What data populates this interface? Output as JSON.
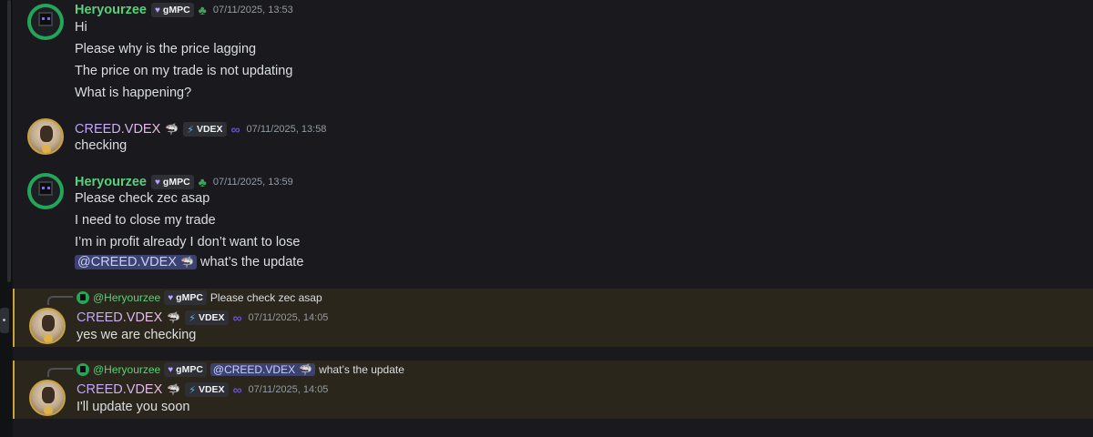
{
  "users": {
    "heryourzee": {
      "name": "Heryourzee",
      "tag": "gMPC",
      "mention": "@Heryourzee"
    },
    "creed": {
      "name": "CREED.VDEX",
      "tag": "VDEX",
      "mention": "@CREED.VDEX"
    }
  },
  "colors": {
    "green_name": "#57d17a",
    "highlight_border": "#c9a23b",
    "mention_bg": "#3c4270"
  },
  "icons": {
    "heart": "heart-icon",
    "clover": "clover-icon",
    "shark": "shark-icon",
    "bolt": "bolt-icon",
    "knot": "knot-icon"
  },
  "messages": [
    {
      "author": "Heryourzee",
      "timestamp": "07/11/2025, 13:53",
      "lines": [
        "Hi",
        "Please why is the price lagging",
        "The price on my trade is not updating",
        "What is happening?"
      ]
    },
    {
      "author": "CREED.VDEX",
      "timestamp": "07/11/2025, 13:58",
      "lines": [
        "checking"
      ]
    },
    {
      "author": "Heryourzee",
      "timestamp": "07/11/2025, 13:59",
      "lines": [
        "Please check zec asap",
        "I need to close my trade",
        "I’m in profit already I don’t want to lose"
      ],
      "mention_line": {
        "mention": "@CREED.VDEX",
        "text": "what’s the update"
      }
    },
    {
      "author": "CREED.VDEX",
      "timestamp": "07/11/2025, 14:05",
      "reply_to": {
        "user": "@Heryourzee",
        "tag": "gMPC",
        "text": "Please check zec asap"
      },
      "lines": [
        "yes we are checking"
      ]
    },
    {
      "author": "CREED.VDEX",
      "timestamp": "07/11/2025, 14:05",
      "reply_to": {
        "user": "@Heryourzee",
        "tag": "gMPC",
        "mention": "@CREED.VDEX",
        "text": "what’s the update"
      },
      "lines": [
        "I'll update you soon"
      ]
    }
  ]
}
